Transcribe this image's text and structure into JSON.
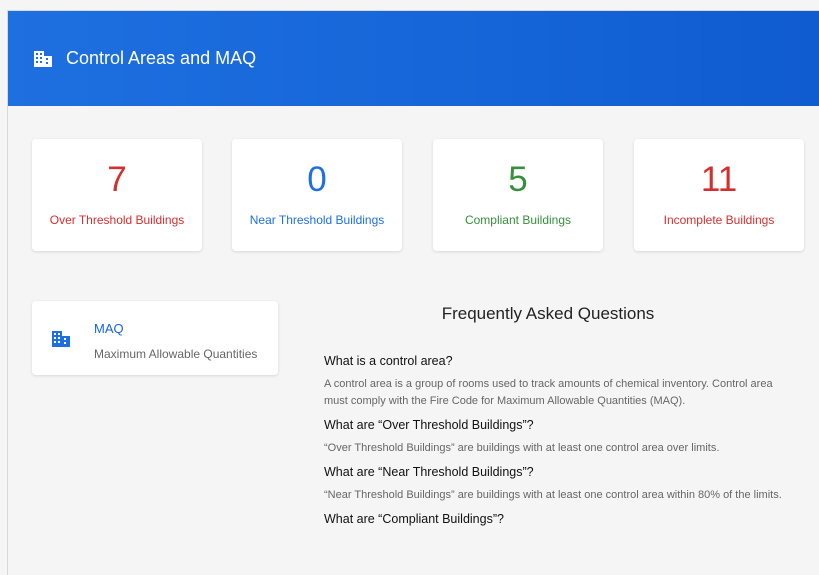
{
  "header": {
    "title": "Control Areas and MAQ",
    "icon": "building-icon"
  },
  "colors": {
    "red": "#d32f2f",
    "blue": "#1e6fe0",
    "green": "#388e3c"
  },
  "stats": [
    {
      "value": "7",
      "label": "Over Threshold Buildings"
    },
    {
      "value": "0",
      "label": "Near Threshold Buildings"
    },
    {
      "value": "5",
      "label": "Compliant Buildings"
    },
    {
      "value": "11",
      "label": "Incomplete Buildings"
    }
  ],
  "maq": {
    "title": "MAQ",
    "subtitle": "Maximum Allowable Quantities",
    "icon": "building-icon"
  },
  "faq": {
    "title": "Frequently Asked Questions",
    "items": [
      {
        "q": "What is a control area?",
        "a": "A control area is a group of rooms used to track amounts of chemical inventory. Control area must comply with the Fire Code for Maximum Allowable Quantities (MAQ)."
      },
      {
        "q": "What are “Over Threshold Buildings”?",
        "a": "“Over Threshold Buildings” are buildings with at least one control area over limits."
      },
      {
        "q": "What are “Near Threshold Buildings”?",
        "a": "“Near Threshold Buildings” are buildings with at least one control area within 80% of the limits."
      },
      {
        "q": "What are “Compliant Buildings”?",
        "a": ""
      }
    ]
  }
}
